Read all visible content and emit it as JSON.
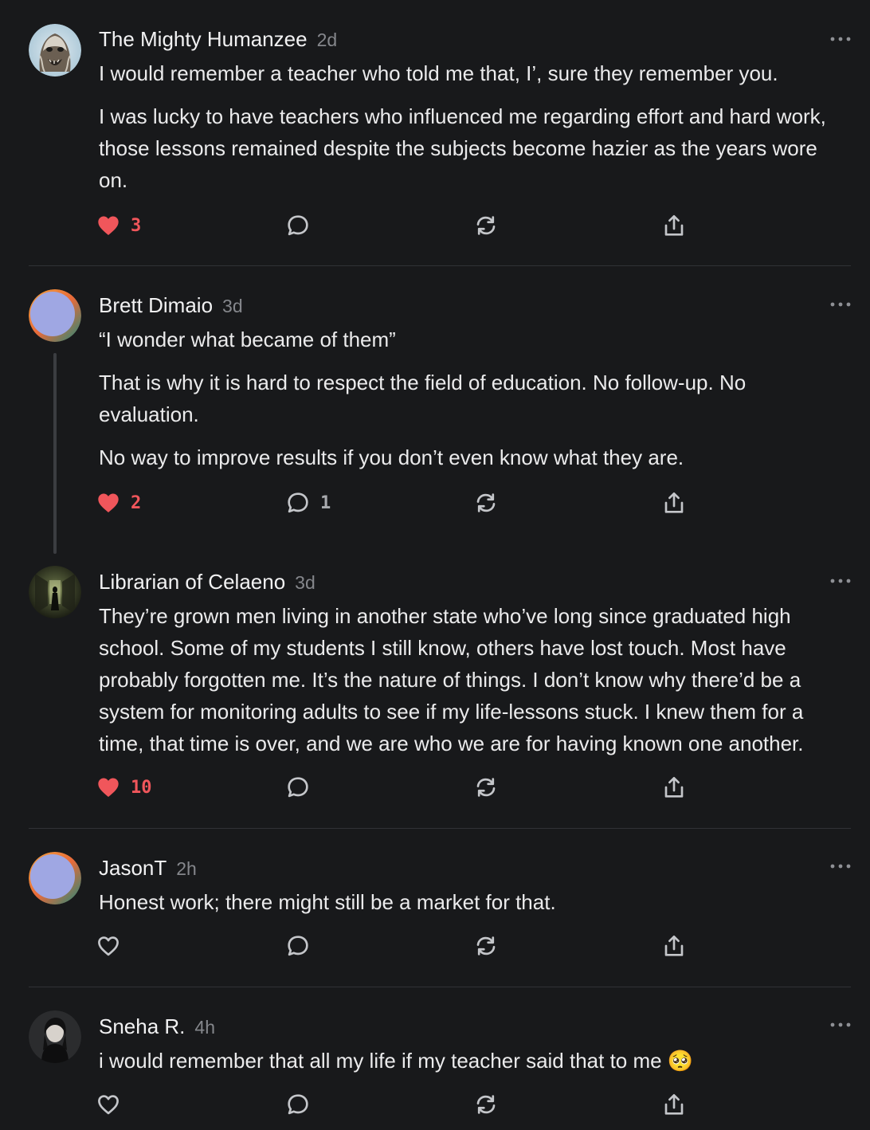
{
  "comments": [
    {
      "author": "The Mighty Humanzee",
      "time": "2d",
      "avatar": "bigfoot-avatar",
      "paragraphs": [
        "I would remember a teacher who told me that, I’, sure they remember you.",
        "I was lucky to have teachers who influenced me regarding effort and hard work, those lessons remained despite the subjects become hazier as the years wore on."
      ],
      "likes": "3",
      "liked": true,
      "replies": ""
    },
    {
      "author": "Brett Dimaio",
      "time": "3d",
      "avatar": "default-gradient-avatar",
      "paragraphs": [
        "“I wonder what became of them”",
        "That is why it is hard to respect the field of education. No follow-up. No evaluation.",
        "No way to improve results if you don’t even know what they are."
      ],
      "likes": "2",
      "liked": true,
      "replies": "1"
    },
    {
      "author": "Librarian of Celaeno",
      "time": "3d",
      "avatar": "dark-hallway-avatar",
      "paragraphs": [
        "They’re grown men living in another state who’ve long since graduated high school. Some of my students I still know, others have lost touch. Most have probably forgotten me. It’s the nature of things. I don’t know why there’d be a system for monitoring adults to see if my life-lessons stuck. I knew them for a time, that time is over, and we are who we are for having known one another."
      ],
      "likes": "10",
      "liked": true,
      "replies": ""
    },
    {
      "author": "JasonT",
      "time": "2h",
      "avatar": "default-gradient-avatar",
      "paragraphs": [
        "Honest work; there might still be a market for that."
      ],
      "likes": "",
      "liked": false,
      "replies": ""
    },
    {
      "author": "Sneha R.",
      "time": "4h",
      "avatar": "photo-avatar",
      "paragraphs": [
        "i would remember that all my life if my teacher said that to me 🥺"
      ],
      "likes": "",
      "liked": false,
      "replies": ""
    }
  ],
  "icons": {
    "like": "heart-icon",
    "reply": "speech-bubble-icon",
    "restack": "restack-arrows-icon",
    "share": "share-upload-icon",
    "menu": "more-dots-icon"
  },
  "colors": {
    "background": "#18191b",
    "text": "#ebebec",
    "muted": "#85878c",
    "like_active": "#f0565b",
    "divider": "#303236"
  }
}
